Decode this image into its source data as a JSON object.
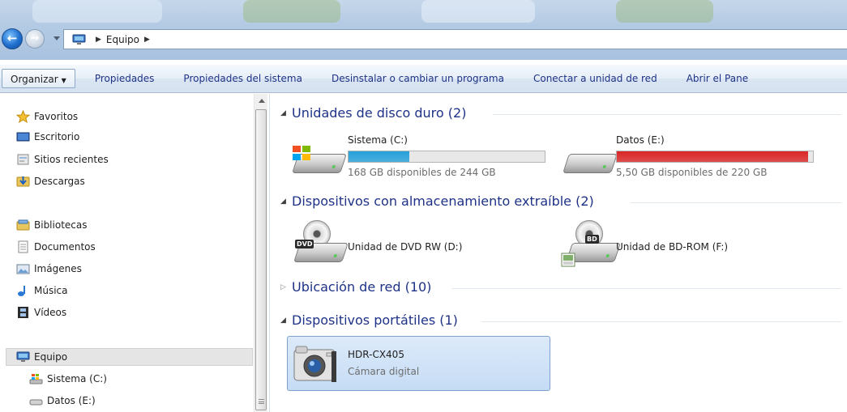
{
  "address": {
    "crumbs": [
      "Equipo"
    ]
  },
  "commands": {
    "organize": "Organizar",
    "properties": "Propiedades",
    "system_properties": "Propiedades del sistema",
    "uninstall": "Desinstalar o cambiar un programa",
    "map_drive": "Conectar a unidad de red",
    "open_panel": "Abrir el Pane"
  },
  "nav": {
    "favorites": "Favoritos",
    "desktop": "Escritorio",
    "recent": "Sitios recientes",
    "downloads": "Descargas",
    "libraries": "Bibliotecas",
    "documents": "Documentos",
    "pictures": "Imágenes",
    "music": "Música",
    "videos": "Vídeos",
    "computer": "Equipo",
    "sys_drive": "Sistema (C:)",
    "data_drive": "Datos (E:)"
  },
  "groups": {
    "hdd": "Unidades de disco duro (2)",
    "removable": "Dispositivos con almacenamiento extraíble (2)",
    "network": "Ubicación de red (10)",
    "portable": "Dispositivos portátiles (1)"
  },
  "drives": {
    "c": {
      "name": "Sistema (C:)",
      "free": "168 GB disponibles de 244 GB",
      "used_fraction": 0.31
    },
    "e": {
      "name": "Datos (E:)",
      "free": "5,50 GB disponibles de 220 GB",
      "used_fraction": 0.975
    }
  },
  "removable": {
    "dvd": {
      "name": "Unidad de DVD RW (D:)",
      "badge": "DVD"
    },
    "bd": {
      "name": "Unidad de BD-ROM (F:)",
      "badge": "BD"
    }
  },
  "portable": {
    "camera": {
      "name": "HDR-CX405",
      "type": "Cámara digital"
    }
  },
  "colors": {
    "bar_normal": "#26a0da",
    "bar_full": "#da2626",
    "group_header": "#1e3287"
  }
}
